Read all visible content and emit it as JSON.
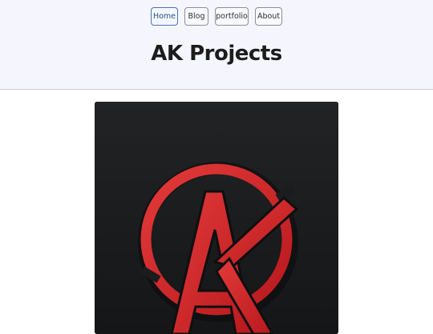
{
  "nav": {
    "items": [
      {
        "label": "Home",
        "active": true
      },
      {
        "label": "Blog",
        "active": false
      },
      {
        "label": "portfolio",
        "active": false
      },
      {
        "label": "About",
        "active": false
      }
    ]
  },
  "header": {
    "title": "AK Projects"
  },
  "hero": {
    "image": "ak-logo-image",
    "colors": {
      "background": "#1b1c1e",
      "accent": "#d8282b"
    }
  }
}
